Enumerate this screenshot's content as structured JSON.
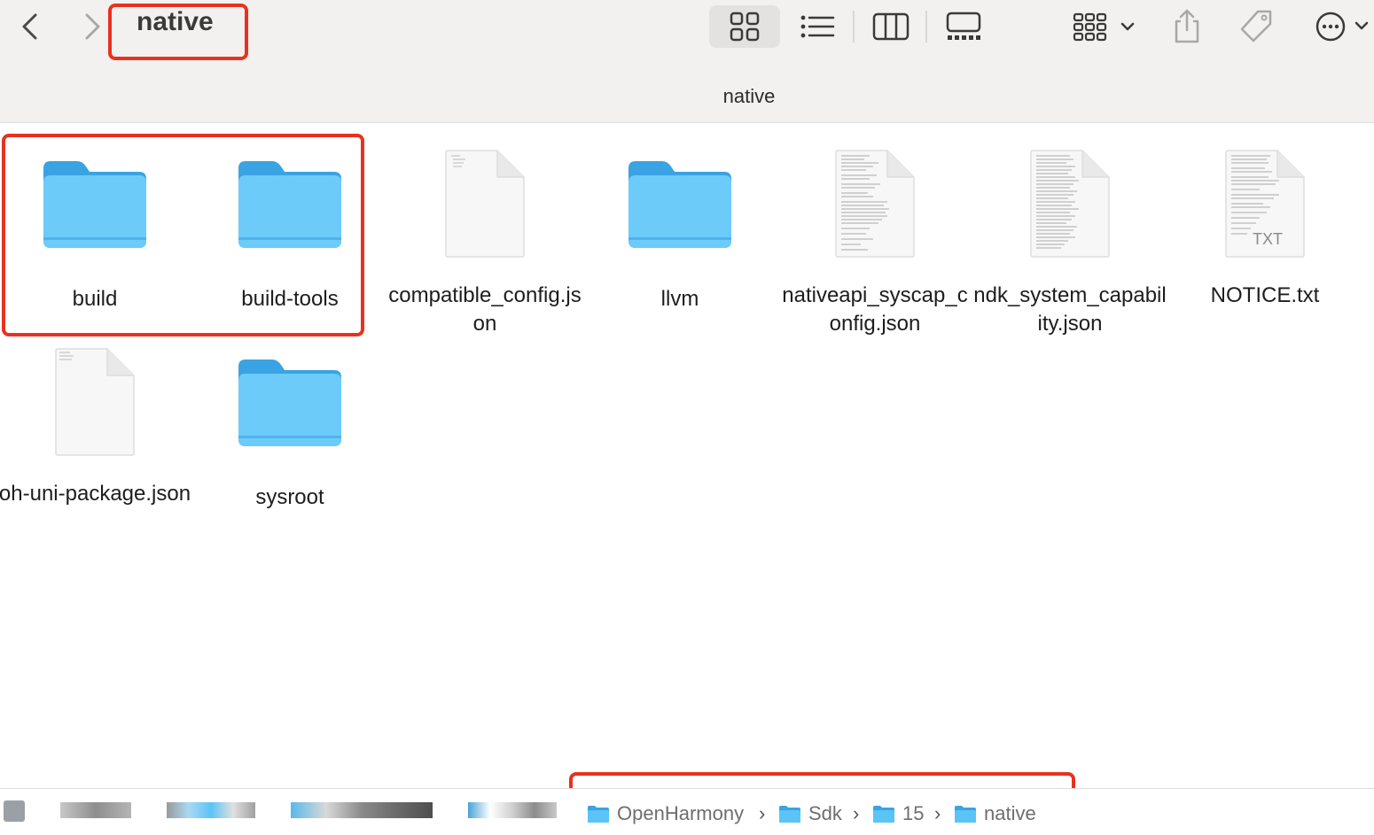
{
  "window": {
    "title": "native",
    "path_title": "native"
  },
  "toolbar": {
    "back": "chevron-left-icon",
    "forward": "chevron-right-icon",
    "view_icons": "icon-view-icon",
    "view_list": "list-view-icon",
    "view_columns": "column-view-icon",
    "view_gallery": "gallery-view-icon",
    "group": "group-icon",
    "share": "share-icon",
    "tag": "tag-icon",
    "more": "more-icon"
  },
  "items": [
    {
      "name": "build",
      "kind": "folder"
    },
    {
      "name": "build-tools",
      "kind": "folder"
    },
    {
      "name": "compatible_config.json",
      "kind": "document"
    },
    {
      "name": "llvm",
      "kind": "folder"
    },
    {
      "name": "nativeapi_syscap_config.json",
      "kind": "document"
    },
    {
      "name": "ndk_system_capability.json",
      "kind": "document"
    },
    {
      "name": "NOTICE.txt",
      "kind": "text",
      "badge": "TXT"
    },
    {
      "name": "oh-uni-package.json",
      "kind": "document"
    },
    {
      "name": "sysroot",
      "kind": "folder"
    }
  ],
  "breadcrumb": [
    {
      "label": "OpenHarmony"
    },
    {
      "label": "Sdk"
    },
    {
      "label": "15"
    },
    {
      "label": "native"
    }
  ],
  "colors": {
    "highlight": "#e8321f",
    "folder": "#5ac4f7",
    "folder_tab": "#3aa3e3"
  }
}
